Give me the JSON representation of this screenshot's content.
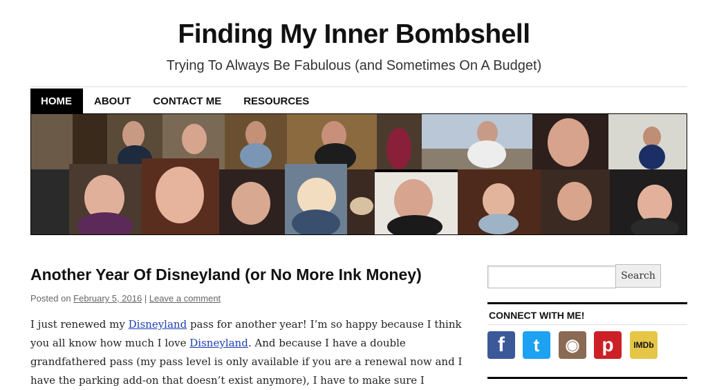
{
  "site": {
    "title": "Finding My Inner Bombshell",
    "description": "Trying To Always Be Fabulous (and Sometimes On A Budget)"
  },
  "nav": {
    "items": [
      {
        "label": "HOME",
        "active": true
      },
      {
        "label": "ABOUT",
        "active": false
      },
      {
        "label": "CONTACT ME",
        "active": false
      },
      {
        "label": "RESOURCES",
        "active": false
      }
    ]
  },
  "post": {
    "title": "Another Year Of Disneyland (or No More Ink Money)",
    "meta_prefix": "Posted on",
    "date": "February 5, 2016",
    "separator": "|",
    "comment_link": "Leave a comment",
    "p1_a": "I just renewed my ",
    "p1_link1": "Disneyland",
    "p1_b": " pass for another year! I’m so happy because I think you all know how much I love ",
    "p1_link2": "Disneyland",
    "p1_c": ". And because I have a double grandfathered pass (my pass level is only available if you are a renewal now and I have the parking add-on that doesn’t exist anymore), I have to make sure I"
  },
  "sidebar": {
    "search_button": "Search",
    "search_placeholder": "",
    "widget_title": "CONNECT WITH ME!",
    "social": [
      {
        "name": "facebook-icon",
        "glyph": "f",
        "color": "#3b5998"
      },
      {
        "name": "twitter-icon",
        "glyph": "t",
        "color": "#1da1f2"
      },
      {
        "name": "instagram-icon",
        "glyph": "◉",
        "color": "#8a6a52"
      },
      {
        "name": "pinterest-icon",
        "glyph": "p",
        "color": "#cb2027"
      },
      {
        "name": "imdb-icon",
        "glyph": "IMDb",
        "color": "#e6c547"
      }
    ]
  },
  "colors": {
    "link": "#1b3fb0",
    "nav_active_bg": "#000000",
    "rule": "#000000"
  }
}
